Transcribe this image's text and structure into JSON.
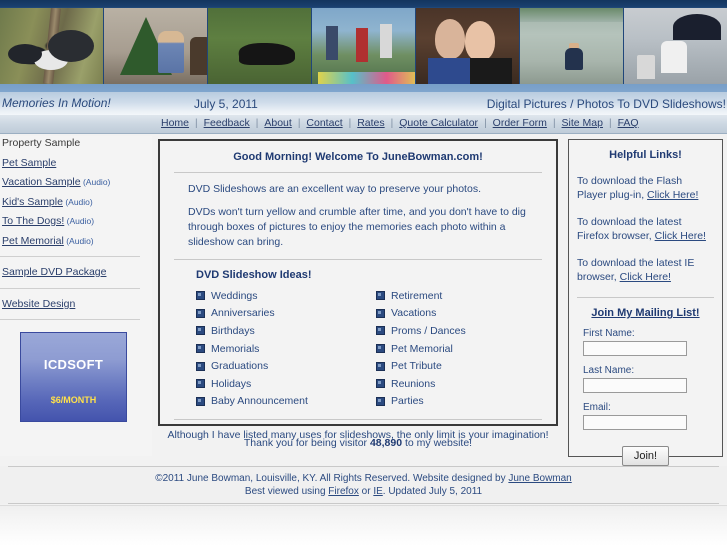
{
  "banner": {
    "photos": [
      "two-dogs-on-grass-photo",
      "christmas-tree-with-person-photo",
      "black-dog-in-grass-photo",
      "band-playing-outdoors-photo",
      "two-girls-faces-photo",
      "girl-sitting-in-water-photo",
      "girl-under-umbrella-photo"
    ]
  },
  "titlebar": {
    "site_tagline": "Memories In Motion!",
    "date": "July 5, 2011",
    "slogan": "Digital Pictures / Photos To DVD Slideshows!"
  },
  "nav": {
    "items": [
      "Home",
      "Feedback",
      "About",
      "Contact",
      "Rates",
      "Quote Calculator",
      "Order Form",
      "Site Map",
      "FAQ"
    ],
    "separator": "|"
  },
  "sidebar_left": {
    "items": [
      {
        "label": "Property Sample",
        "link": false,
        "audio": ""
      },
      {
        "label": "Pet Sample",
        "link": true,
        "audio": ""
      },
      {
        "label": "Vacation Sample",
        "link": true,
        "audio": "(Audio)"
      },
      {
        "label": "Kid's Sample",
        "link": true,
        "audio": "(Audio)"
      },
      {
        "label": "To The Dogs!",
        "link": true,
        "audio": "(Audio)"
      },
      {
        "label": "Pet Memorial",
        "link": true,
        "audio": "(Audio)"
      }
    ],
    "items2": [
      {
        "label": "Sample DVD Package",
        "link": true,
        "audio": ""
      }
    ],
    "items3": [
      {
        "label": "Website Design",
        "link": true,
        "audio": ""
      }
    ],
    "ad": {
      "name": "ICDSOFT",
      "price": "$6/MONTH"
    }
  },
  "main": {
    "heading": "Good Morning! Welcome To JuneBowman.com!",
    "paragraph1": "DVD Slideshows are an excellent way to preserve your photos.",
    "paragraph2": "DVDs won't turn yellow and crumble after time, and you don't have to dig through boxes of pictures to enjoy the memories each photo within a slideshow can bring.",
    "ideas_heading": "DVD Slideshow Ideas!",
    "ideas_left": [
      "Weddings",
      "Anniversaries",
      "Birthdays",
      "Memorials",
      "Graduations",
      "Holidays",
      "Baby Announcement"
    ],
    "ideas_right": [
      "Retirement",
      "Vacations",
      "Proms / Dances",
      "Pet Memorial",
      "Pet Tribute",
      "Reunions",
      "Parties"
    ],
    "closing": "Although I have listed many uses for slideshows, the only limit is your imagination!"
  },
  "sidebar_right": {
    "heading": "Helpful Links!",
    "links": [
      {
        "text": "To download the Flash Player plug-in,",
        "cta": "Click Here!"
      },
      {
        "text": "To download the latest Firefox browser,",
        "cta": "Click Here!"
      },
      {
        "text": "To download the latest IE browser,",
        "cta": "Click Here!"
      }
    ],
    "mailing_heading": "Join My Mailing List!",
    "fields": [
      {
        "label": "First Name:",
        "value": "",
        "placeholder": ""
      },
      {
        "label": "Last Name:",
        "value": "",
        "placeholder": ""
      },
      {
        "label": "Email:",
        "value": "",
        "placeholder": ""
      }
    ],
    "join_button": "Join!"
  },
  "visitor": {
    "prefix": "Thank you for being visitor ",
    "count": "48,890",
    "suffix": " to my website!"
  },
  "footer": {
    "line1_a": "©2011 June Bowman, Louisville, KY. All Rights Reserved. Website designed by ",
    "line1_link": "June Bowman",
    "line2_a": "Best viewed using ",
    "line2_link1": "Firefox",
    "line2_b": " or ",
    "line2_link2": "IE",
    "line2_c": ". Updated July 5, 2011"
  },
  "colors": {
    "banner_navy": "#13355f",
    "title_blue": "#2b4a7d",
    "link_blue": "#2b3f6b",
    "heading_blue": "#1f3a72",
    "body_blue": "#2b4a80",
    "ad_bg": "#5666b8",
    "ad_price": "#ffe14a"
  }
}
